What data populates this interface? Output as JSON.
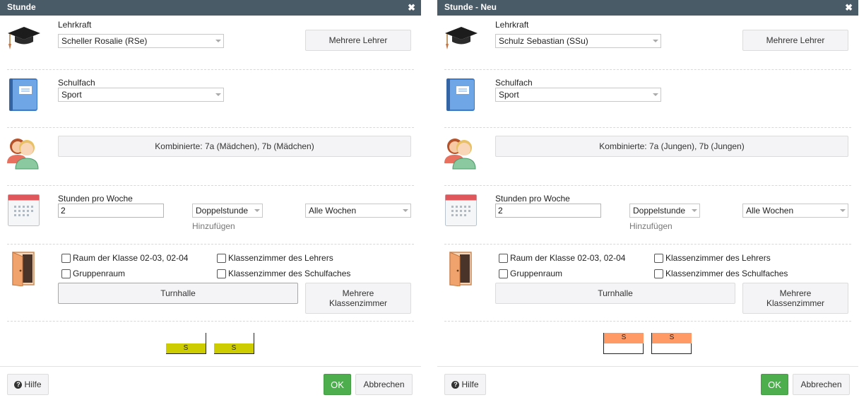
{
  "dialogs": [
    {
      "title": "Stunde",
      "close_icon": "✖",
      "teacher": {
        "label": "Lehrkraft",
        "value": "Scheller Rosalie (RSe)",
        "more_button": "Mehrere Lehrer"
      },
      "subject": {
        "label": "Schulfach",
        "value": "Sport"
      },
      "classes": {
        "button": "Kombinierte: 7a (Mädchen), 7b (Mädchen)"
      },
      "hours": {
        "label": "Stunden pro Woche",
        "value": "2",
        "double_select": "Doppelstunde",
        "weeks_select": "Alle Wochen",
        "add_link": "Hinzufügen"
      },
      "rooms": {
        "checkboxes": [
          "Raum der Klasse 02-03, 02-04",
          "Klassenzimmer des Lehrers",
          "Gruppenraum",
          "Klassenzimmer des Schulfaches"
        ],
        "room_button": "Turnhalle",
        "more_rooms_button": [
          "Mehrere",
          "Klassenzimmer"
        ]
      },
      "lessons": {
        "color": "#cccc00",
        "position": "bottom",
        "items": [
          "S",
          "S"
        ]
      },
      "footer": {
        "help": "Hilfe",
        "ok": "OK",
        "cancel": "Abbrechen"
      }
    },
    {
      "title": "Stunde - Neu",
      "close_icon": "✖",
      "teacher": {
        "label": "Lehrkraft",
        "value": "Schulz Sebastian (SSu)",
        "more_button": "Mehrere Lehrer"
      },
      "subject": {
        "label": "Schulfach",
        "value": "Sport"
      },
      "classes": {
        "button": "Kombinierte: 7a (Jungen), 7b (Jungen)"
      },
      "hours": {
        "label": "Stunden pro Woche",
        "value": "2",
        "double_select": "Doppelstunde",
        "weeks_select": "Alle Wochen",
        "add_link": "Hinzufügen"
      },
      "rooms": {
        "checkboxes": [
          "Raum der Klasse 02-03, 02-04",
          "Klassenzimmer des Lehrers",
          "Gruppenraum",
          "Klassenzimmer des Schulfaches"
        ],
        "room_button": "Turnhalle",
        "more_rooms_button": [
          "Mehrere",
          "Klassenzimmer"
        ]
      },
      "lessons": {
        "color": "#ff9966",
        "position": "top",
        "items": [
          "S",
          "S"
        ]
      },
      "footer": {
        "help": "Hilfe",
        "ok": "OK",
        "cancel": "Abbrechen"
      }
    }
  ]
}
